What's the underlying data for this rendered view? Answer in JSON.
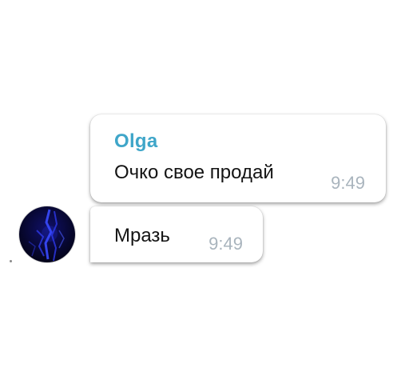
{
  "colors": {
    "sender_name": "#3fa6c9",
    "message_text": "#141414",
    "timestamp": "#a9b4bd",
    "bubble_background": "#ffffff",
    "avatar_background": "#05051a",
    "avatar_glow": "#2a3cff"
  },
  "messages": [
    {
      "sender": "Olga",
      "text": "Очко свое продай",
      "time": "9:49"
    },
    {
      "text": "Мразь",
      "time": "9:49",
      "avatar_icon": "avatar-blue-abstract-icon"
    }
  ]
}
